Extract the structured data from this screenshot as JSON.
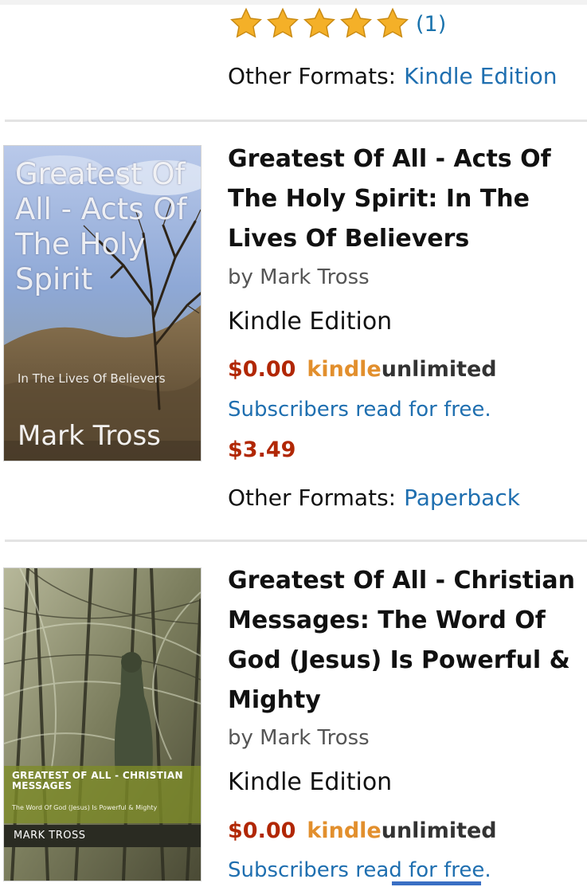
{
  "top_result": {
    "rating_stars": 5,
    "rating_count": "(1)",
    "other_formats_label": "Other Formats:",
    "other_formats_link": "Kindle Edition"
  },
  "results": [
    {
      "cover": {
        "title": "Greatest Of All - Acts Of The Holy Spirit",
        "subtitle": "In The Lives Of Believers",
        "author": "Mark Tross"
      },
      "title": "Greatest Of All - Acts Of The Holy Spirit: In The Lives Of Believers",
      "byline": "by Mark Tross",
      "edition": "Kindle Edition",
      "price_free": "$0.00",
      "ku_kindle": "kindle",
      "ku_unlimited": "unlimited",
      "subscribers": "Subscribers read for free.",
      "price_paid": "$3.49",
      "other_formats_label": "Other Formats:",
      "other_formats_link": "Paperback"
    },
    {
      "cover": {
        "title": "GREATEST OF ALL - CHRISTIAN MESSAGES",
        "subtitle": "The Word Of God (Jesus) Is Powerful & Mighty",
        "author": "MARK TROSS"
      },
      "title": "Greatest Of All - Christian Messages: The Word Of God (Jesus) Is Powerful & Mighty",
      "byline": "by Mark Tross",
      "edition": "Kindle Edition",
      "price_free": "$0.00",
      "ku_kindle": "kindle",
      "ku_unlimited": "unlimited",
      "subscribers": "Subscribers read for free."
    }
  ],
  "colors": {
    "price": "#b12704",
    "link": "#1f6fb0",
    "kindle_orange": "#e28f2d",
    "star": "#f4b028"
  }
}
